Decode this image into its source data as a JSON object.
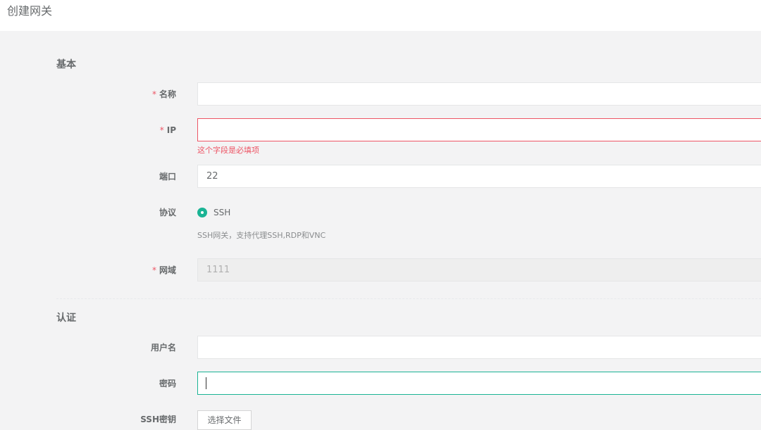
{
  "page": {
    "title": "创建网关"
  },
  "basic": {
    "section_title": "基本",
    "name": {
      "label": "名称",
      "value": ""
    },
    "ip": {
      "label": "IP",
      "value": "",
      "error": "这个字段是必填项"
    },
    "port": {
      "label": "端口",
      "value": "22"
    },
    "protocol": {
      "label": "协议",
      "option": "SSH",
      "help": "SSH网关，支持代理SSH,RDP和VNC"
    },
    "domain": {
      "label": "网域",
      "value": "1111"
    }
  },
  "auth": {
    "section_title": "认证",
    "username": {
      "label": "用户名",
      "value": ""
    },
    "password": {
      "label": "密码",
      "value": ""
    },
    "ssh_key": {
      "label": "SSH密钥",
      "button_label": "选择文件"
    }
  },
  "required_mark": "*",
  "colors": {
    "accent": "#1ab394",
    "error": "#ed5565",
    "text": "#676a6c",
    "background": "#f3f3f4"
  }
}
